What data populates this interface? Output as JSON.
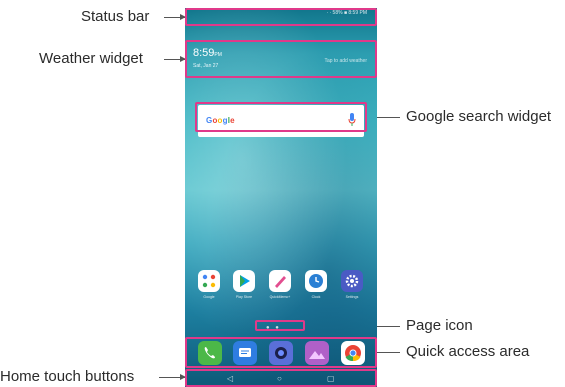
{
  "labels": {
    "status_bar": "Status bar",
    "weather_widget": "Weather widget",
    "google_search_widget": "Google search widget",
    "page_icon": "Page icon",
    "quick_access_area": "Quick access area",
    "home_touch_buttons": "Home touch buttons"
  },
  "phone": {
    "time": "8:59",
    "ampm": "PM",
    "date": "Sat, Jan 27",
    "tap_text": "Tap to add weather",
    "status_text": " · · 58% ■ 8:59 PM",
    "google_label": "Google"
  },
  "apps": [
    {
      "name": "Google",
      "icon": "folder-icon",
      "color": "#ffffff"
    },
    {
      "name": "Play Store",
      "icon": "play-store-icon",
      "color": "#ffffff"
    },
    {
      "name": "QuickMemo+",
      "icon": "pen-icon",
      "color": "#ffffff"
    },
    {
      "name": "Clock",
      "icon": "clock-icon",
      "color": "#ffffff"
    },
    {
      "name": "Settings",
      "icon": "gear-icon",
      "color": "#4a5bc4"
    }
  ],
  "dock": [
    {
      "icon": "phone-icon",
      "color": "#4cb848"
    },
    {
      "icon": "messages-icon",
      "color": "#2f7de1"
    },
    {
      "icon": "camera-icon",
      "color": "#5a6fd8"
    },
    {
      "icon": "gallery-icon",
      "color": "#b060c8"
    },
    {
      "icon": "chrome-icon",
      "color": "#ffffff"
    }
  ],
  "colors": {
    "highlight": "#e0398a",
    "leader_line": "#555555"
  }
}
